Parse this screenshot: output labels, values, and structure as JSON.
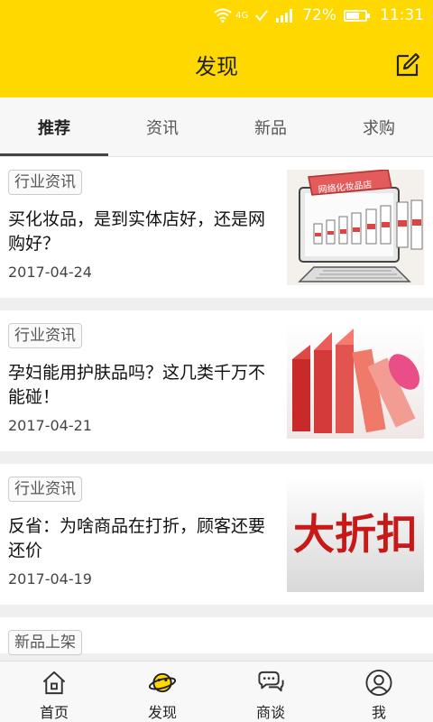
{
  "status": {
    "signal_label": "4G",
    "battery": "72%",
    "battery_level": 0.72,
    "time": "11:31"
  },
  "header": {
    "title": "发现"
  },
  "tabs": [
    {
      "label": "推荐",
      "active": true
    },
    {
      "label": "资讯",
      "active": false
    },
    {
      "label": "新品",
      "active": false
    },
    {
      "label": "求购",
      "active": false
    }
  ],
  "feed": [
    {
      "tag": "行业资讯",
      "headline": "买化妆品，是到实体店好，还是网购好？",
      "date": "2017-04-24",
      "thumb_text": "网络化妆品店"
    },
    {
      "tag": "行业资讯",
      "headline": "孕妇能用护肤品吗？这几类千万不能碰！",
      "date": "2017-04-21"
    },
    {
      "tag": "行业资讯",
      "headline": "反省：为啥商品在打折，顾客还要还价",
      "date": "2017-04-19",
      "thumb_text": "大折扣"
    },
    {
      "tag": "新品上架"
    }
  ],
  "nav": [
    {
      "label": "首页",
      "icon": "home-icon"
    },
    {
      "label": "发现",
      "icon": "planet-icon"
    },
    {
      "label": "商谈",
      "icon": "chat-icon"
    },
    {
      "label": "我",
      "icon": "user-icon"
    }
  ],
  "colors": {
    "brand": "#ffd800"
  }
}
